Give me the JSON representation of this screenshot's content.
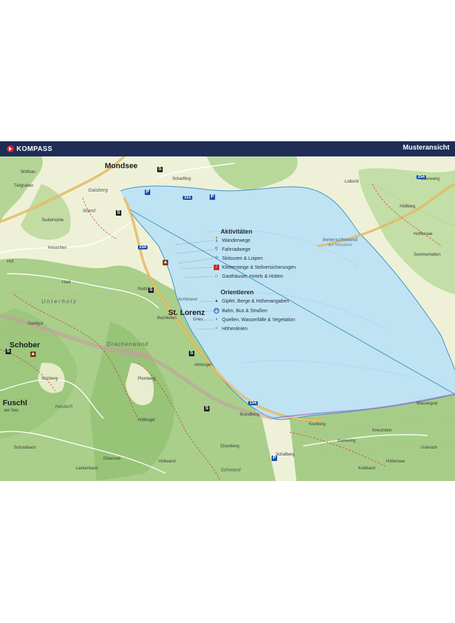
{
  "header": {
    "brand": "KOMPASS",
    "sample_label": "Musteransicht"
  },
  "legend": {
    "activities_title": "Aktivitäten",
    "activities": [
      {
        "label": "Wanderwege",
        "icon": "hiker-icon",
        "color": "#d6312a"
      },
      {
        "label": "Fahrradwege",
        "icon": "bicycle-icon",
        "color": "#2a64b0"
      },
      {
        "label": "Skitouren & Loipen",
        "icon": "skier-icon",
        "color": "#4a90c8"
      },
      {
        "label": "Klettersteige & Seilversicherungen",
        "icon": "climbing-icon",
        "color": "#c62a2a"
      },
      {
        "label": "Gasthäuser, Hotels & Hütten",
        "icon": "hut-icon",
        "color": "#7a3b16"
      }
    ],
    "orientation_title": "Orientieren",
    "orientation": [
      {
        "label": "Gipfel, Berge & Höhenangaben",
        "icon": "summit-icon",
        "color": "#3a3a3a"
      },
      {
        "label": "Bahn, Bus & Straßen",
        "icon": "bus-icon",
        "color": "#1d4fa8"
      },
      {
        "label": "Quellen, Wasserfälle & Vegetation",
        "icon": "spring-icon",
        "color": "#2a7ac0"
      },
      {
        "label": "Höhenlinien",
        "icon": "contour-icon",
        "color": "#8a6a3a"
      }
    ]
  },
  "places": {
    "mondsee": "Mondsee",
    "st_lorenz": "St. Lorenz",
    "schober": "Schober",
    "fuschl": "Fuschl",
    "fuschl_sub": "am See",
    "drachenwand": "Drachenwand",
    "innerschwand": "Innerschwand",
    "innerschwand_sub": "am Mondsee",
    "unterholz": "Unterholz",
    "gaisberg": "Gaisberg",
    "wand": "Wand",
    "plomberg": "Plomberg",
    "brandberg": "Brandberg",
    "kienberg": "Kienberg",
    "hofgau": "Hof",
    "sulzberg": "Sulzberg",
    "elsenberg": "Elsenberg",
    "schwand": "Schwand",
    "schranbach": "Schranbach",
    "eibensee": "Eibensee",
    "scharfling": "Scharfling",
    "hoellberg": "Höllberg",
    "wassergrat": "Wassergrat",
    "loibichl": "Loibichl",
    "teufelmuehle": "Teufelmühle",
    "haslach": "Haslach",
    "hoffensee": "Hoffensee",
    "hoellwand": "Höllwand",
    "sommerhalten": "Sommerhalten",
    "kreuzstein": "Kreuzstein",
    "oberwang": "Oberwang",
    "kamering": "Kamering",
    "unterach": "Unterach",
    "tiefgraben": "Tiefgraben",
    "keuschen": "Keuschen",
    "huettensee": "Hüttensee",
    "gries": "Gries",
    "reith": "Reith",
    "bachleiten": "Bachleiten",
    "achbrand": "Achbrand",
    "haid": "Haid",
    "hoellkogel": "Höllkogel",
    "schafberg": "Schafberg",
    "lackenbach": "Lackenbach",
    "wolfsau": "Wolfsau",
    "almkogel": "Almkogel",
    "kolkbach": "Kolkbach",
    "gastlgut": "Gastlgut"
  },
  "roads": {
    "r151": "151",
    "r154": "154",
    "r154b": "154",
    "r254": "254"
  },
  "colors": {
    "lake": "#bfe3f3",
    "forest": "#a9cf8a",
    "meadow": "#eef1d8",
    "banner": "#1f2d57"
  }
}
